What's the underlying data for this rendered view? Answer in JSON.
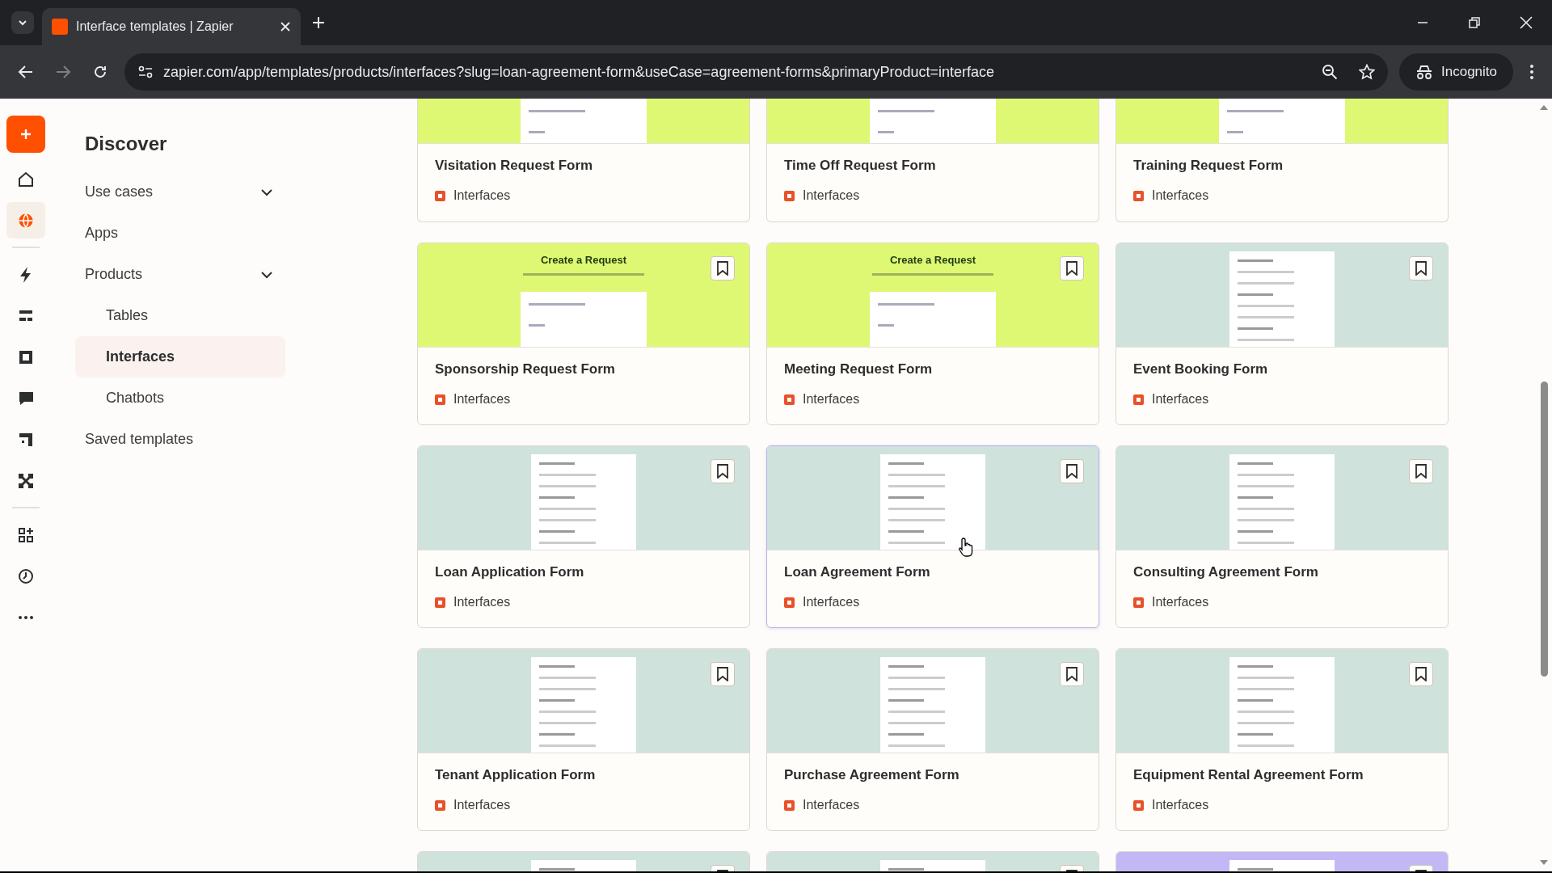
{
  "browser": {
    "tab": {
      "title": "Interface templates | Zapier"
    },
    "address": "zapier.com/app/templates/products/interfaces?slug=loan-agreement-form&useCase=agreement-forms&primaryProduct=interface",
    "profile": "Incognito"
  },
  "rail": {
    "items": [
      {
        "selected": false
      },
      {
        "selected": true
      },
      {
        "selected": false
      },
      {
        "selected": false
      },
      {
        "selected": false
      },
      {
        "selected": false
      },
      {
        "selected": false
      },
      {
        "selected": false
      },
      {
        "selected": false
      },
      {
        "selected": false
      },
      {
        "selected": false
      }
    ]
  },
  "nav": {
    "title": "Discover",
    "items": [
      {
        "label": "Use cases",
        "kind": "group",
        "selected": false
      },
      {
        "label": "Apps",
        "kind": "link",
        "selected": false
      },
      {
        "label": "Products",
        "kind": "group",
        "selected": false,
        "children": [
          {
            "label": "Tables",
            "selected": false
          },
          {
            "label": "Interfaces",
            "selected": true
          },
          {
            "label": "Chatbots",
            "selected": false
          }
        ]
      },
      {
        "label": "Saved templates",
        "kind": "link",
        "selected": false
      }
    ]
  },
  "cards": [
    {
      "title": "Visitation Request Form",
      "product": "Interfaces",
      "preview": {
        "kind": "lime",
        "cropped": true
      },
      "highlighted": false
    },
    {
      "title": "Time Off Request Form",
      "product": "Interfaces",
      "preview": {
        "kind": "lime",
        "cropped": true
      },
      "highlighted": false
    },
    {
      "title": "Training Request Form",
      "product": "Interfaces",
      "preview": {
        "kind": "lime",
        "cropped": true
      },
      "highlighted": false
    },
    {
      "title": "Sponsorship Request Form",
      "product": "Interfaces",
      "preview": {
        "kind": "lime",
        "heading": "Create a Request"
      },
      "highlighted": false
    },
    {
      "title": "Meeting Request Form",
      "product": "Interfaces",
      "preview": {
        "kind": "lime",
        "heading": "Create a Request"
      },
      "highlighted": false
    },
    {
      "title": "Event Booking Form",
      "product": "Interfaces",
      "preview": {
        "kind": "mint"
      },
      "highlighted": false
    },
    {
      "title": "Loan Application Form",
      "product": "Interfaces",
      "preview": {
        "kind": "mint"
      },
      "highlighted": false
    },
    {
      "title": "Loan Agreement Form",
      "product": "Interfaces",
      "preview": {
        "kind": "mint"
      },
      "highlighted": true
    },
    {
      "title": "Consulting Agreement Form",
      "product": "Interfaces",
      "preview": {
        "kind": "mint"
      },
      "highlighted": false
    },
    {
      "title": "Tenant Application Form",
      "product": "Interfaces",
      "preview": {
        "kind": "mint"
      },
      "highlighted": false
    },
    {
      "title": "Purchase Agreement Form",
      "product": "Interfaces",
      "preview": {
        "kind": "mint"
      },
      "highlighted": false
    },
    {
      "title": "Equipment Rental Agreement Form",
      "product": "Interfaces",
      "preview": {
        "kind": "mint"
      },
      "highlighted": false
    },
    {
      "preview": {
        "kind": "mint"
      },
      "highlighted": false
    },
    {
      "preview": {
        "kind": "mint"
      },
      "highlighted": false
    },
    {
      "preview": {
        "kind": "purple"
      },
      "highlighted": false
    }
  ]
}
